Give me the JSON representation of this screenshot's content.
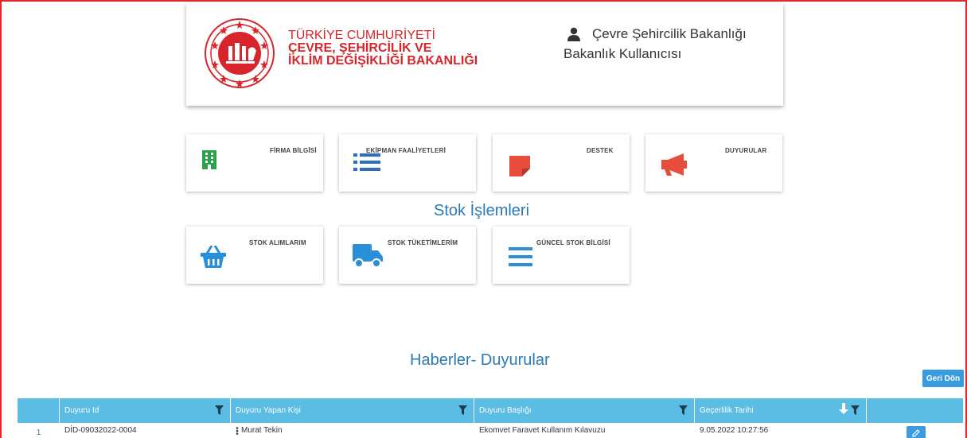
{
  "header": {
    "ministry_line1": "TÜRKİYE CUMHURİYETİ",
    "ministry_line2": "ÇEVRE, ŞEHİRCİLİK VE",
    "ministry_line3": "İKLİM DEĞİŞİKLİĞİ BAKANLIĞI",
    "user_org": "Çevre Şehircilik Bakanlığı",
    "user_role": "Bakanlık Kullanıcısı"
  },
  "tiles": {
    "firma": "FİRMA BİLGİSİ",
    "ekipman": "EKİPMAN FAALİYETLERİ",
    "destek": "DESTEK",
    "duyurular": "DUYURULAR",
    "stok_alim": "STOK ALIMLARIM",
    "stok_tuketim": "STOK TÜKETİMLERİM",
    "guncel_stok": "GÜNCEL STOK BİLGİSİ"
  },
  "sections": {
    "stock": "Stok İşlemleri",
    "news": "Haberler- Duyurular"
  },
  "actions": {
    "back": "Geri Dön"
  },
  "grid": {
    "columns": [
      "Duyuru Id",
      "Duyuru Yapan Kişi",
      "Duyuru Başlığı",
      "Geçerlilik Tarihi"
    ],
    "rows": [
      {
        "no": "1",
        "id": "DİD-09032022-0004",
        "person": "Murat Tekin",
        "title": "Ekomvet Faravet Kullanım Kılavuzu",
        "date": "9.05.2022 10:27:56"
      }
    ]
  },
  "colors": {
    "brand_red": "#d7252b",
    "accent_blue": "#3a9ce0",
    "grid_header": "#5bbce4",
    "title_blue": "#2a7ab8"
  }
}
